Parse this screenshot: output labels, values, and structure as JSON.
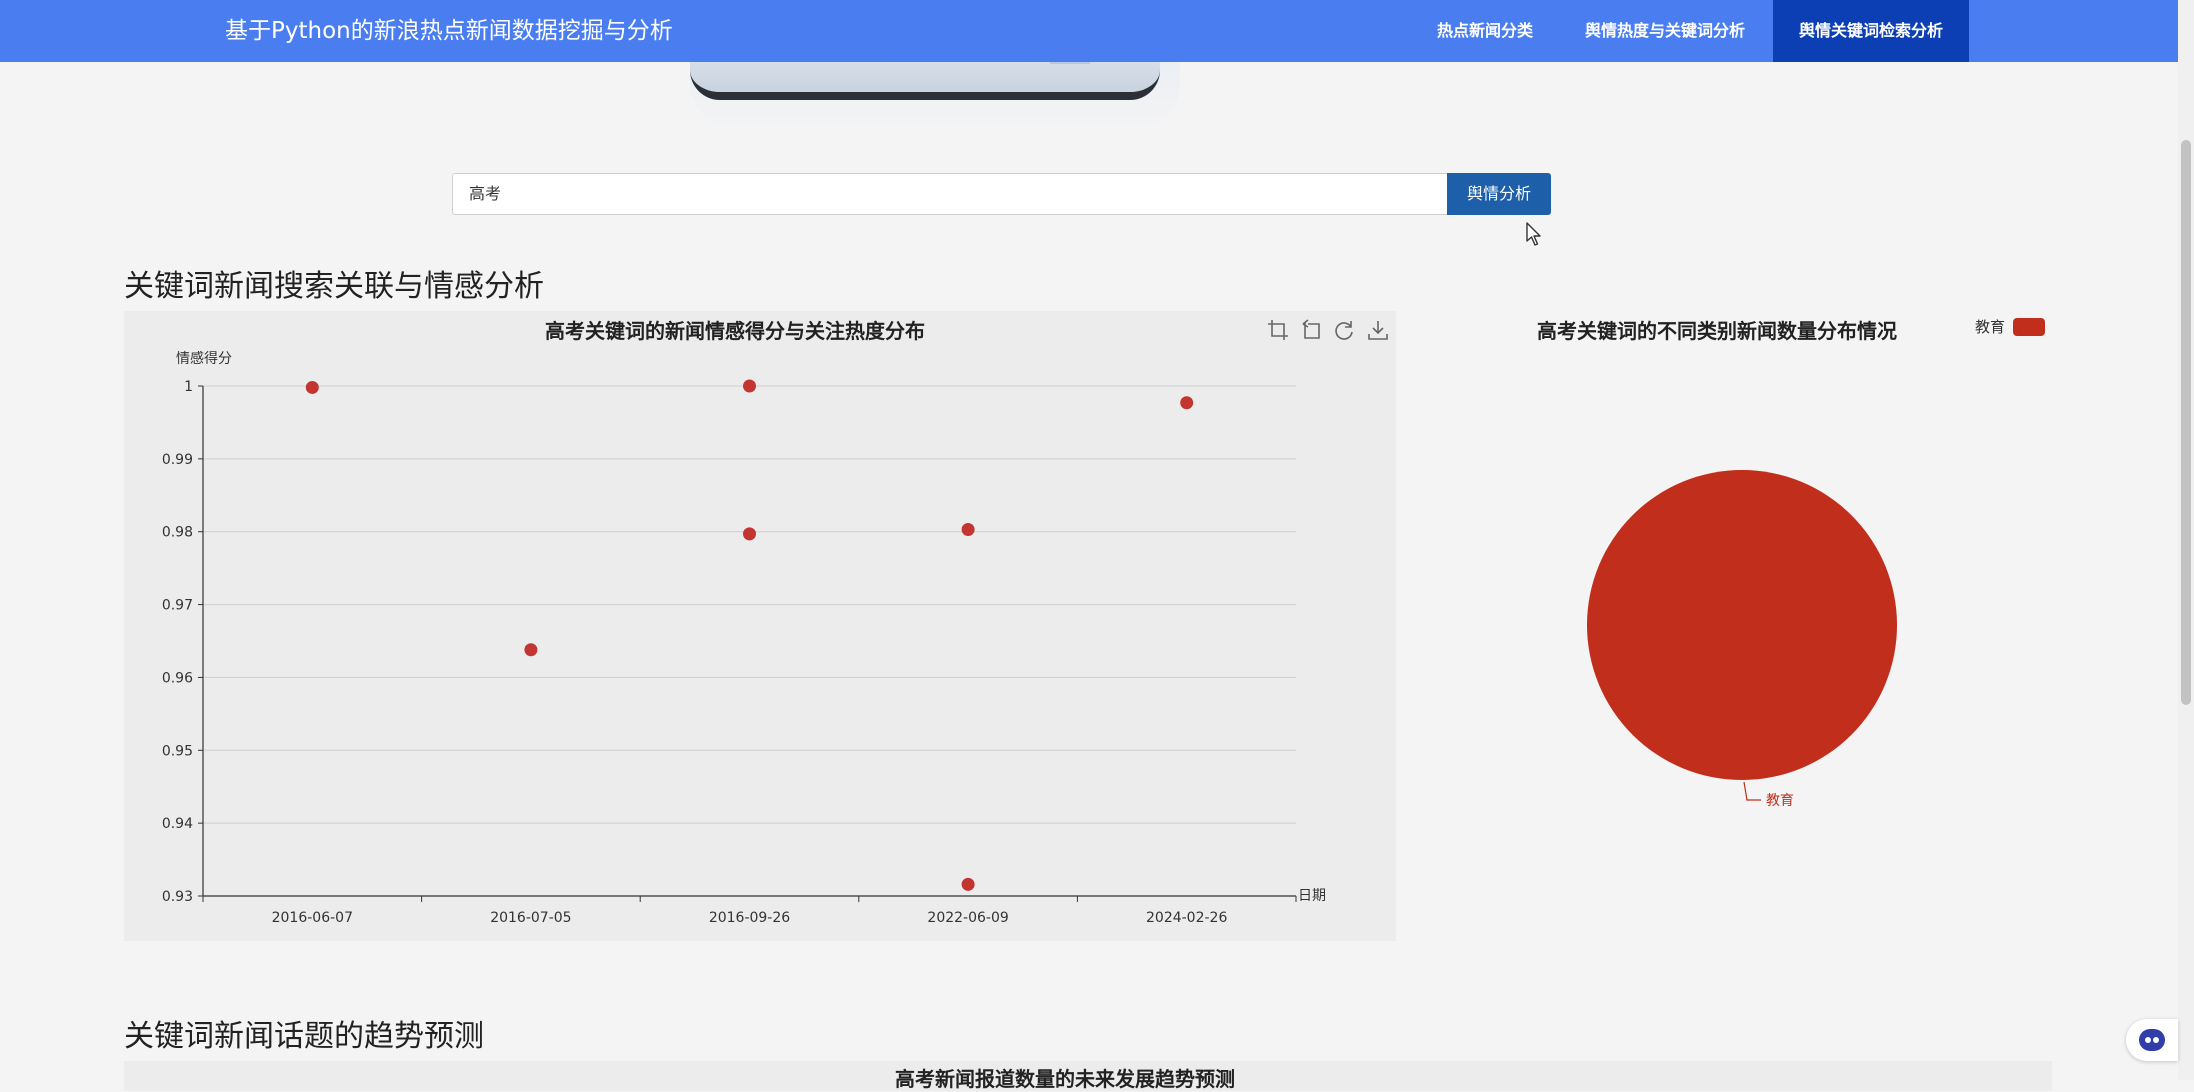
{
  "header": {
    "brand": "基于Python的新浪热点新闻数据挖掘与分析",
    "nav": [
      "热点新闻分类",
      "舆情热度与关键词分析",
      "舆情关键词检索分析"
    ],
    "active_index": 2
  },
  "search": {
    "value": "高考",
    "button_label": "舆情分析"
  },
  "sections": {
    "correlation_heading": "关键词新闻搜索关联与情感分析",
    "trend_heading": "关键词新闻话题的趋势预测"
  },
  "toolbox": {
    "icons": [
      "zoom-icon",
      "zoom-reset-icon",
      "restore-icon",
      "save-image-icon"
    ]
  },
  "colors": {
    "nav_bg": "#4a7ef0",
    "nav_active_bg": "#0b3fb3",
    "button_bg": "#1d5fa8",
    "point_color": "#c23531",
    "pie_color": "#c12e1c"
  },
  "chart_data": [
    {
      "type": "scatter",
      "title": "高考关键词的新闻情感得分与关注热度分布",
      "xlabel": "日期",
      "ylabel": "情感得分",
      "categories": [
        "2016-06-07",
        "2016-07-05",
        "2016-09-26",
        "2022-06-09",
        "2024-02-26"
      ],
      "yticks": [
        "1",
        "0.99",
        "0.98",
        "0.97",
        "0.96",
        "0.95",
        "0.94",
        "0.93"
      ],
      "ylim": [
        0.93,
        1.0
      ],
      "grid": true,
      "points": [
        {
          "x": "2016-06-07",
          "y": 0.9998
        },
        {
          "x": "2016-07-05",
          "y": 0.9638
        },
        {
          "x": "2016-09-26",
          "y": 1.0
        },
        {
          "x": "2016-09-26",
          "y": 0.9797
        },
        {
          "x": "2022-06-09",
          "y": 0.9803
        },
        {
          "x": "2022-06-09",
          "y": 0.9316
        },
        {
          "x": "2024-02-26",
          "y": 0.9977
        }
      ]
    },
    {
      "type": "pie",
      "title": "高考关键词的不同类别新闻数量分布情况",
      "legend": [
        "教育"
      ],
      "legend_position": "top-right",
      "slices": [
        {
          "label": "教育",
          "share": 1.0
        }
      ]
    },
    {
      "type": "line",
      "title": "高考新闻报道数量的未来发展趋势预测"
    }
  ]
}
